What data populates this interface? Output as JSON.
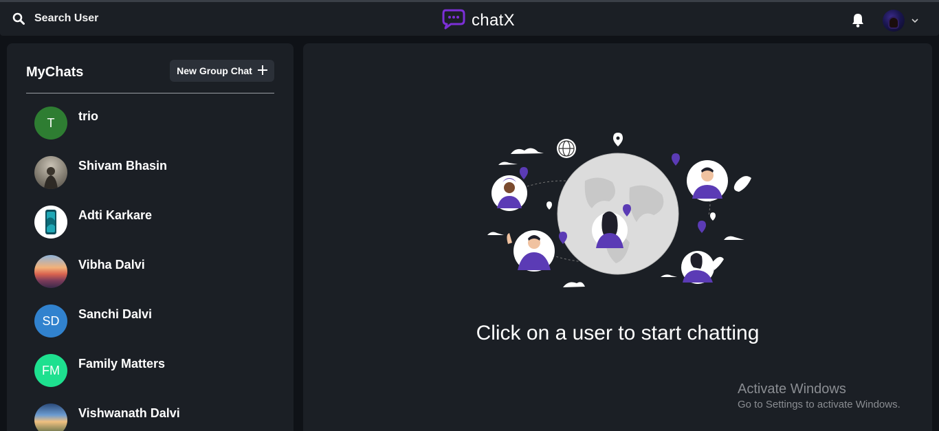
{
  "header": {
    "search_label": "Search User",
    "brand_name": "chatX",
    "brand_color": "#7b2fd6"
  },
  "sidebar": {
    "title": "MyChats",
    "new_group_label": "New Group Chat",
    "chats": [
      {
        "name": "trio",
        "initials": "T",
        "avatar_color": "#2e7d32",
        "avatar_type": "initials"
      },
      {
        "name": "Shivam Bhasin",
        "initials": "",
        "avatar_color": "#8a8478",
        "avatar_type": "photo"
      },
      {
        "name": "Adti Karkare",
        "initials": "",
        "avatar_color": "#ffffff",
        "avatar_type": "photo"
      },
      {
        "name": "Vibha Dalvi",
        "initials": "",
        "avatar_color": "#d98a5a",
        "avatar_type": "photo"
      },
      {
        "name": "Sanchi Dalvi",
        "initials": "SD",
        "avatar_color": "#3182ce",
        "avatar_type": "initials"
      },
      {
        "name": "Family Matters",
        "initials": "FM",
        "avatar_color": "#1ee08f",
        "avatar_type": "initials"
      },
      {
        "name": "Vishwanath Dalvi",
        "initials": "",
        "avatar_color": "#4a7bb0",
        "avatar_type": "photo"
      }
    ]
  },
  "main": {
    "empty_state_text": "Click on a user to start chatting",
    "accent_color": "#5b3bb5"
  },
  "watermark": {
    "title": "Activate Windows",
    "subtitle": "Go to Settings to activate Windows."
  }
}
